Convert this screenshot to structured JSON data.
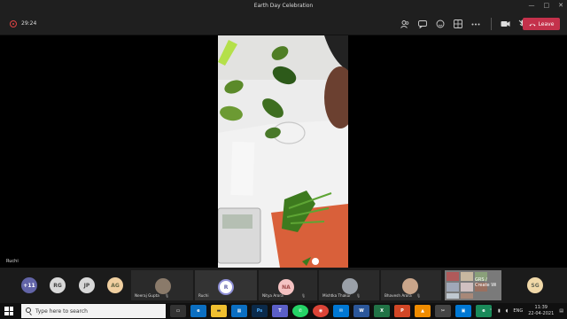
{
  "window": {
    "title": "Earth Day Celebration",
    "controls": [
      "—",
      "□",
      "✕"
    ]
  },
  "toolbar": {
    "timer": "29:24",
    "leave_label": "Leave",
    "icons": [
      "participants-icon",
      "chat-icon",
      "reactions-icon",
      "rooms-icon",
      "more-icon",
      "camera-icon",
      "mic-off-icon",
      "share-icon"
    ]
  },
  "stage": {
    "presenter_name": "Ruchi"
  },
  "roster": {
    "overflow": "+11",
    "initials": [
      "RG",
      "JP",
      "AG"
    ],
    "participants": [
      {
        "name": "Neeraj Gupta",
        "kind": "photo"
      },
      {
        "name": "Ruchi",
        "kind": "initial",
        "initial": "R"
      },
      {
        "name": "Nitya Arora",
        "kind": "initial",
        "initial": "NA"
      },
      {
        "name": "Mishtka Thakur",
        "kind": "photo"
      },
      {
        "name": "Bhavesh Arora",
        "kind": "photo"
      }
    ],
    "self_initial": "SG",
    "gallery_text": "GRS / Create Wi"
  },
  "colors": {
    "leave": "#c4314b",
    "record": "#e04343",
    "accent": "#6264a7"
  },
  "taskbar": {
    "search_placeholder": "Type here to search",
    "apps": [
      "task-view",
      "edge",
      "file-explorer",
      "store",
      "photoshop",
      "teams",
      "whatsapp",
      "chrome",
      "mail",
      "word",
      "excel",
      "powerpoint",
      "vlc",
      "snipping",
      "photos",
      "edge-beta"
    ],
    "lang": "ENG",
    "time": "11:39",
    "date": "22-04-2021"
  }
}
